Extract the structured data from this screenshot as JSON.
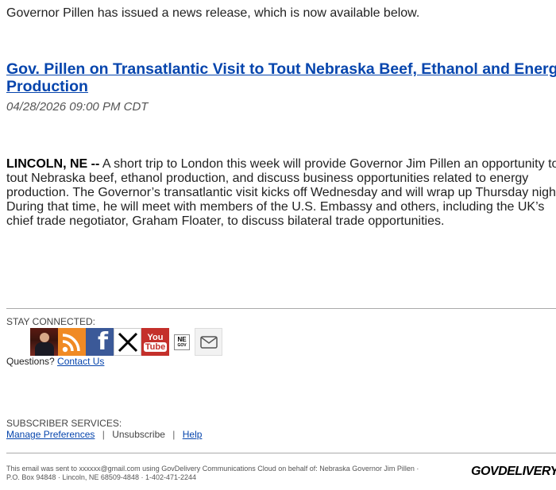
{
  "intro_text": "Governor Pillen has issued a news release, which is now available below.",
  "headline": "Gov. Pillen on Transatlantic Visit to Tout Nebraska Beef, Ethanol and Energy Production",
  "dateline": "04/28/2026 09:00 PM CDT",
  "body": {
    "location": "LINCOLN, NE --",
    "text": " A short trip to London this week will provide Governor Jim Pillen an opportunity to tout Nebraska beef, ethanol production, and discuss business opportunities related to energy production.  The Governor’s transatlantic visit kicks off Wednesday and will wrap up Thursday night. During that time, he will meet with members of the U.S. Embassy and others, including the UK’s chief trade negotiator, Graham Floater, to discuss bilateral trade opportunities."
  },
  "stay_connected": {
    "label": "STAY CONNECTED:",
    "icons": [
      "governor-photo-icon",
      "rss-icon",
      "facebook-icon",
      "x-icon",
      "youtube-icon",
      "ne-gov-icon",
      "email-icon"
    ],
    "youtube_text": [
      "You",
      "Tube"
    ],
    "ne_text": [
      "NE",
      "GOV"
    ]
  },
  "questions": {
    "prefix": "Questions? ",
    "link": "Contact Us"
  },
  "subscriber": {
    "label": "SUBSCRIBER SERVICES:",
    "manage": "Manage Preferences",
    "unsubscribe": "Unsubscribe",
    "help": "Help",
    "separator": "|"
  },
  "footer": {
    "line1": "This email was sent to xxxxxx@gmail.com using GovDelivery Communications Cloud on behalf of: Nebraska Governor Jim Pillen ·",
    "line2": "P.O. Box 94848 · Lincoln, NE 68509-4848 · 1-402-471-2244",
    "logo": "GOVDELIVERY"
  },
  "colors": {
    "link": "#0645ad",
    "rss": "#f08a24",
    "facebook": "#3b5998",
    "youtube": "#c4302b"
  }
}
